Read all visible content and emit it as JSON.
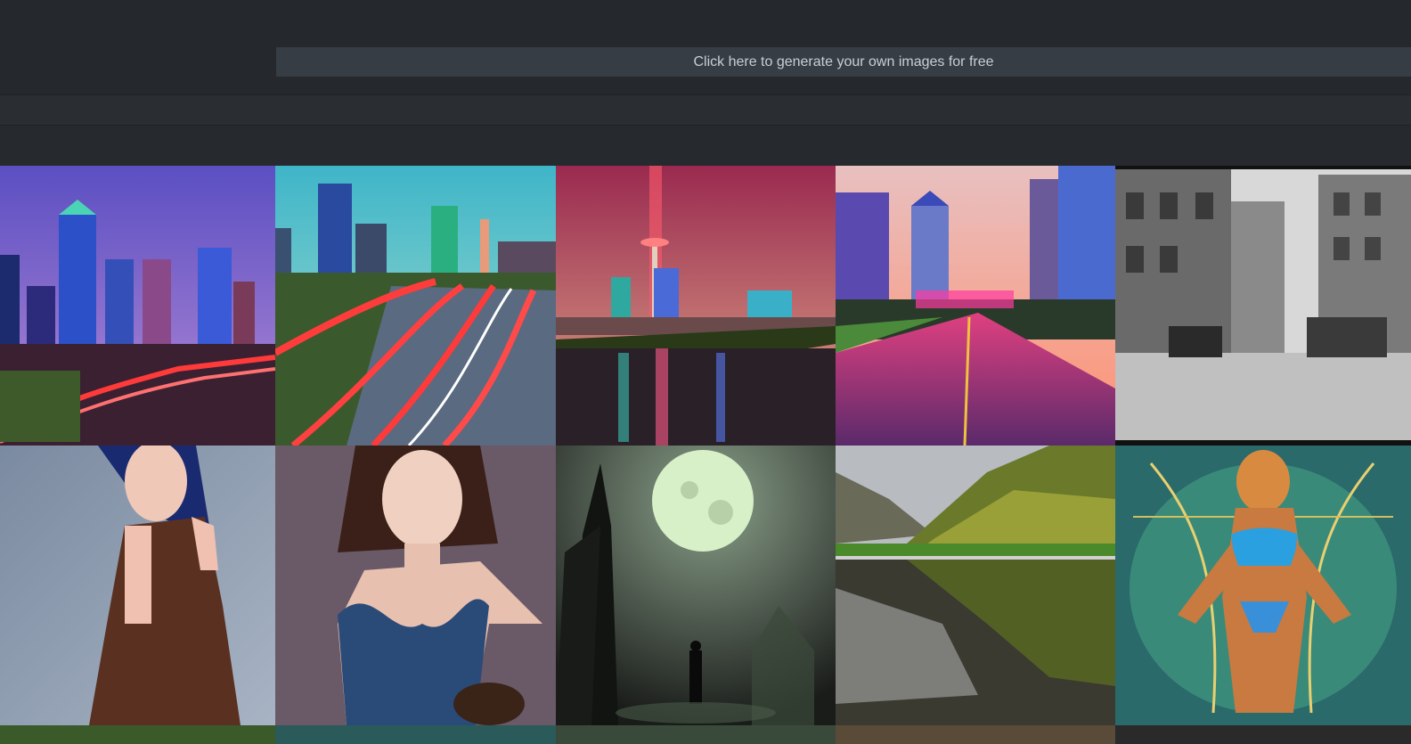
{
  "banner": {
    "text": "Click here to generate your own images for free"
  },
  "gallery": {
    "tiles": [
      {
        "icon": "dallas-skyline-highway-image"
      },
      {
        "icon": "dallas-light-trails-image"
      },
      {
        "icon": "reunion-tower-river-image"
      },
      {
        "icon": "city-street-sunset-image"
      },
      {
        "icon": "vintage-street-bw-image"
      },
      {
        "icon": "anime-girl-blue-hair-image"
      },
      {
        "icon": "anime-girl-brown-hair-image"
      },
      {
        "icon": "gothic-castle-moon-image"
      },
      {
        "icon": "mountain-lake-reflection-image"
      },
      {
        "icon": "neon-figure-art-image"
      }
    ]
  },
  "colors": {
    "page_bg": "#25282d",
    "banner_bg": "#373d45",
    "banner_text": "#c9ced4"
  }
}
